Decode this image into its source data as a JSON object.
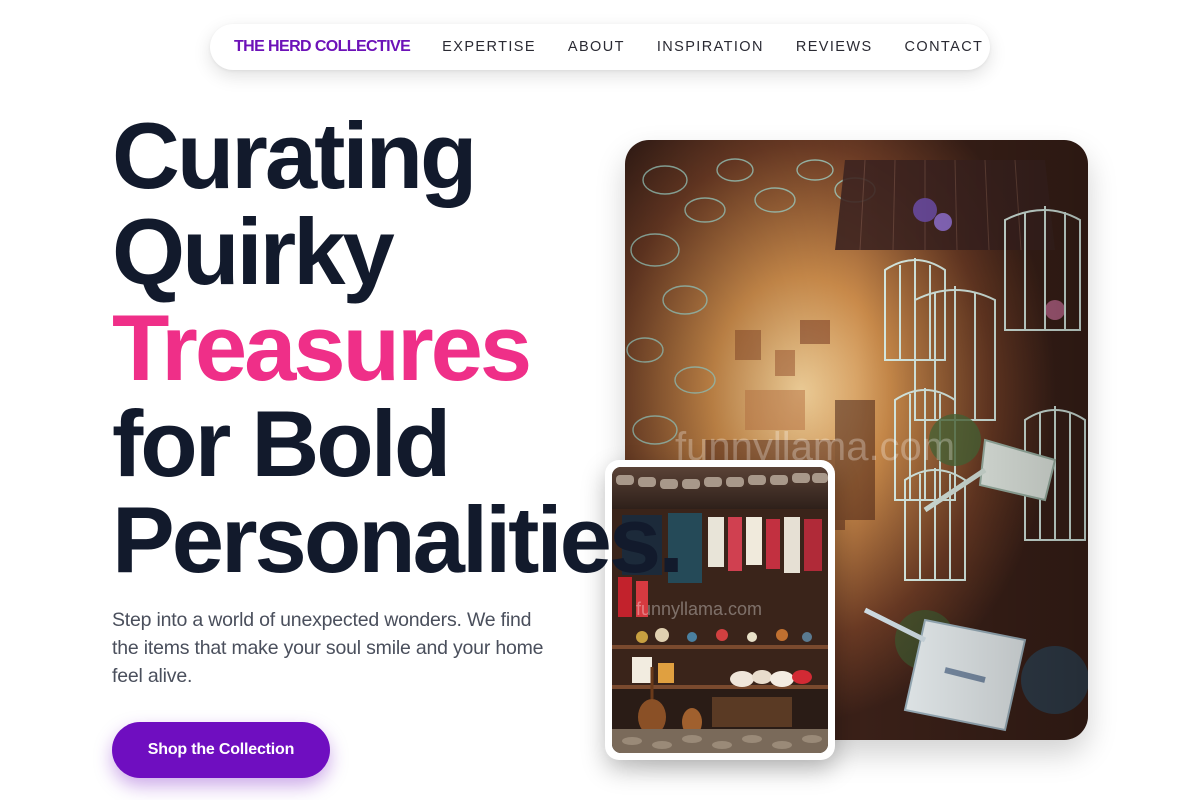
{
  "nav": {
    "brand": "THE HERD COLLECTIVE",
    "links": [
      "EXPERTISE",
      "ABOUT",
      "INSPIRATION",
      "REVIEWS",
      "CONTACT"
    ]
  },
  "hero": {
    "headline_lines": [
      "Curating",
      "Quirky",
      "Treasures",
      "for Bold",
      "Personalities."
    ],
    "subcopy": "Step into a world of unexpected wonders. We find the items that make your soul smile and your home feel alive.",
    "cta_label": "Shop the Collection"
  },
  "images": {
    "main_watermark": "funnyllama.com",
    "small_watermark": "funnyllama.com"
  },
  "colors": {
    "brand": "#6d12b8",
    "accent": "#ef2f88",
    "headline": "#121a2c",
    "cta": "#6f0ec0"
  }
}
